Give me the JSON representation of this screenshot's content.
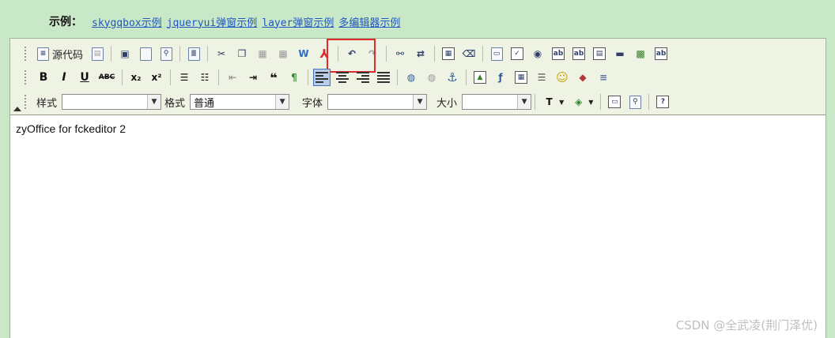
{
  "examples": {
    "label": "示例：",
    "links": [
      "skygqbox示例",
      "jqueryui弹窗示例",
      "layer弹窗示例",
      "多编辑器示例"
    ]
  },
  "toolbar": {
    "source_label": "源代码",
    "style_label": "样式",
    "style_value": "",
    "format_label": "格式",
    "format_value": "普通",
    "font_label": "字体",
    "font_value": "",
    "size_label": "大小",
    "size_value": ""
  },
  "editor": {
    "content": "zyOffice for fckeditor 2"
  },
  "watermark": "CSDN @全武凌(荆门泽优)",
  "colors": {
    "highlight": "#e02c2c",
    "page_bg": "#c9e8c7",
    "link": "#1f56c2"
  }
}
